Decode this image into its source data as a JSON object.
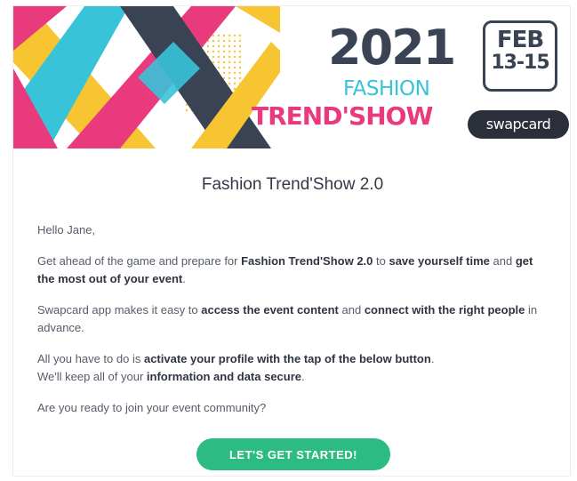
{
  "banner": {
    "year": "2021",
    "event_line1": "FASHION",
    "event_line2": "TREND'SHOW",
    "date_month": "FEB",
    "date_days": "13-15",
    "brand": "swapcard"
  },
  "email": {
    "title": "Fashion Trend'Show 2.0",
    "greeting": "Hello Jane,",
    "p1": {
      "a": "Get ahead of the game and prepare for ",
      "b": "Fashion Trend'Show 2.0",
      "c": " to ",
      "d": "save yourself time",
      "e": " and ",
      "f": "get the most out of your event",
      "g": "."
    },
    "p2": {
      "a": "Swapcard app makes it easy to ",
      "b": "access the event content",
      "c": " and ",
      "d": "connect with the right people",
      "e": " in advance."
    },
    "p3": {
      "a": "All you have to do is ",
      "b": "activate your profile with the tap of the below button",
      "c": ".",
      "d": "We'll keep all of your ",
      "e": "information and data secure",
      "f": "."
    },
    "question": "Are you ready to join your event community?",
    "cta": "LET'S GET STARTED!"
  },
  "colors": {
    "accent_green": "#2dbb84",
    "pink": "#e83a7d",
    "cyan": "#38c3d8",
    "yellow": "#f7c531",
    "navy": "#3a4353"
  }
}
